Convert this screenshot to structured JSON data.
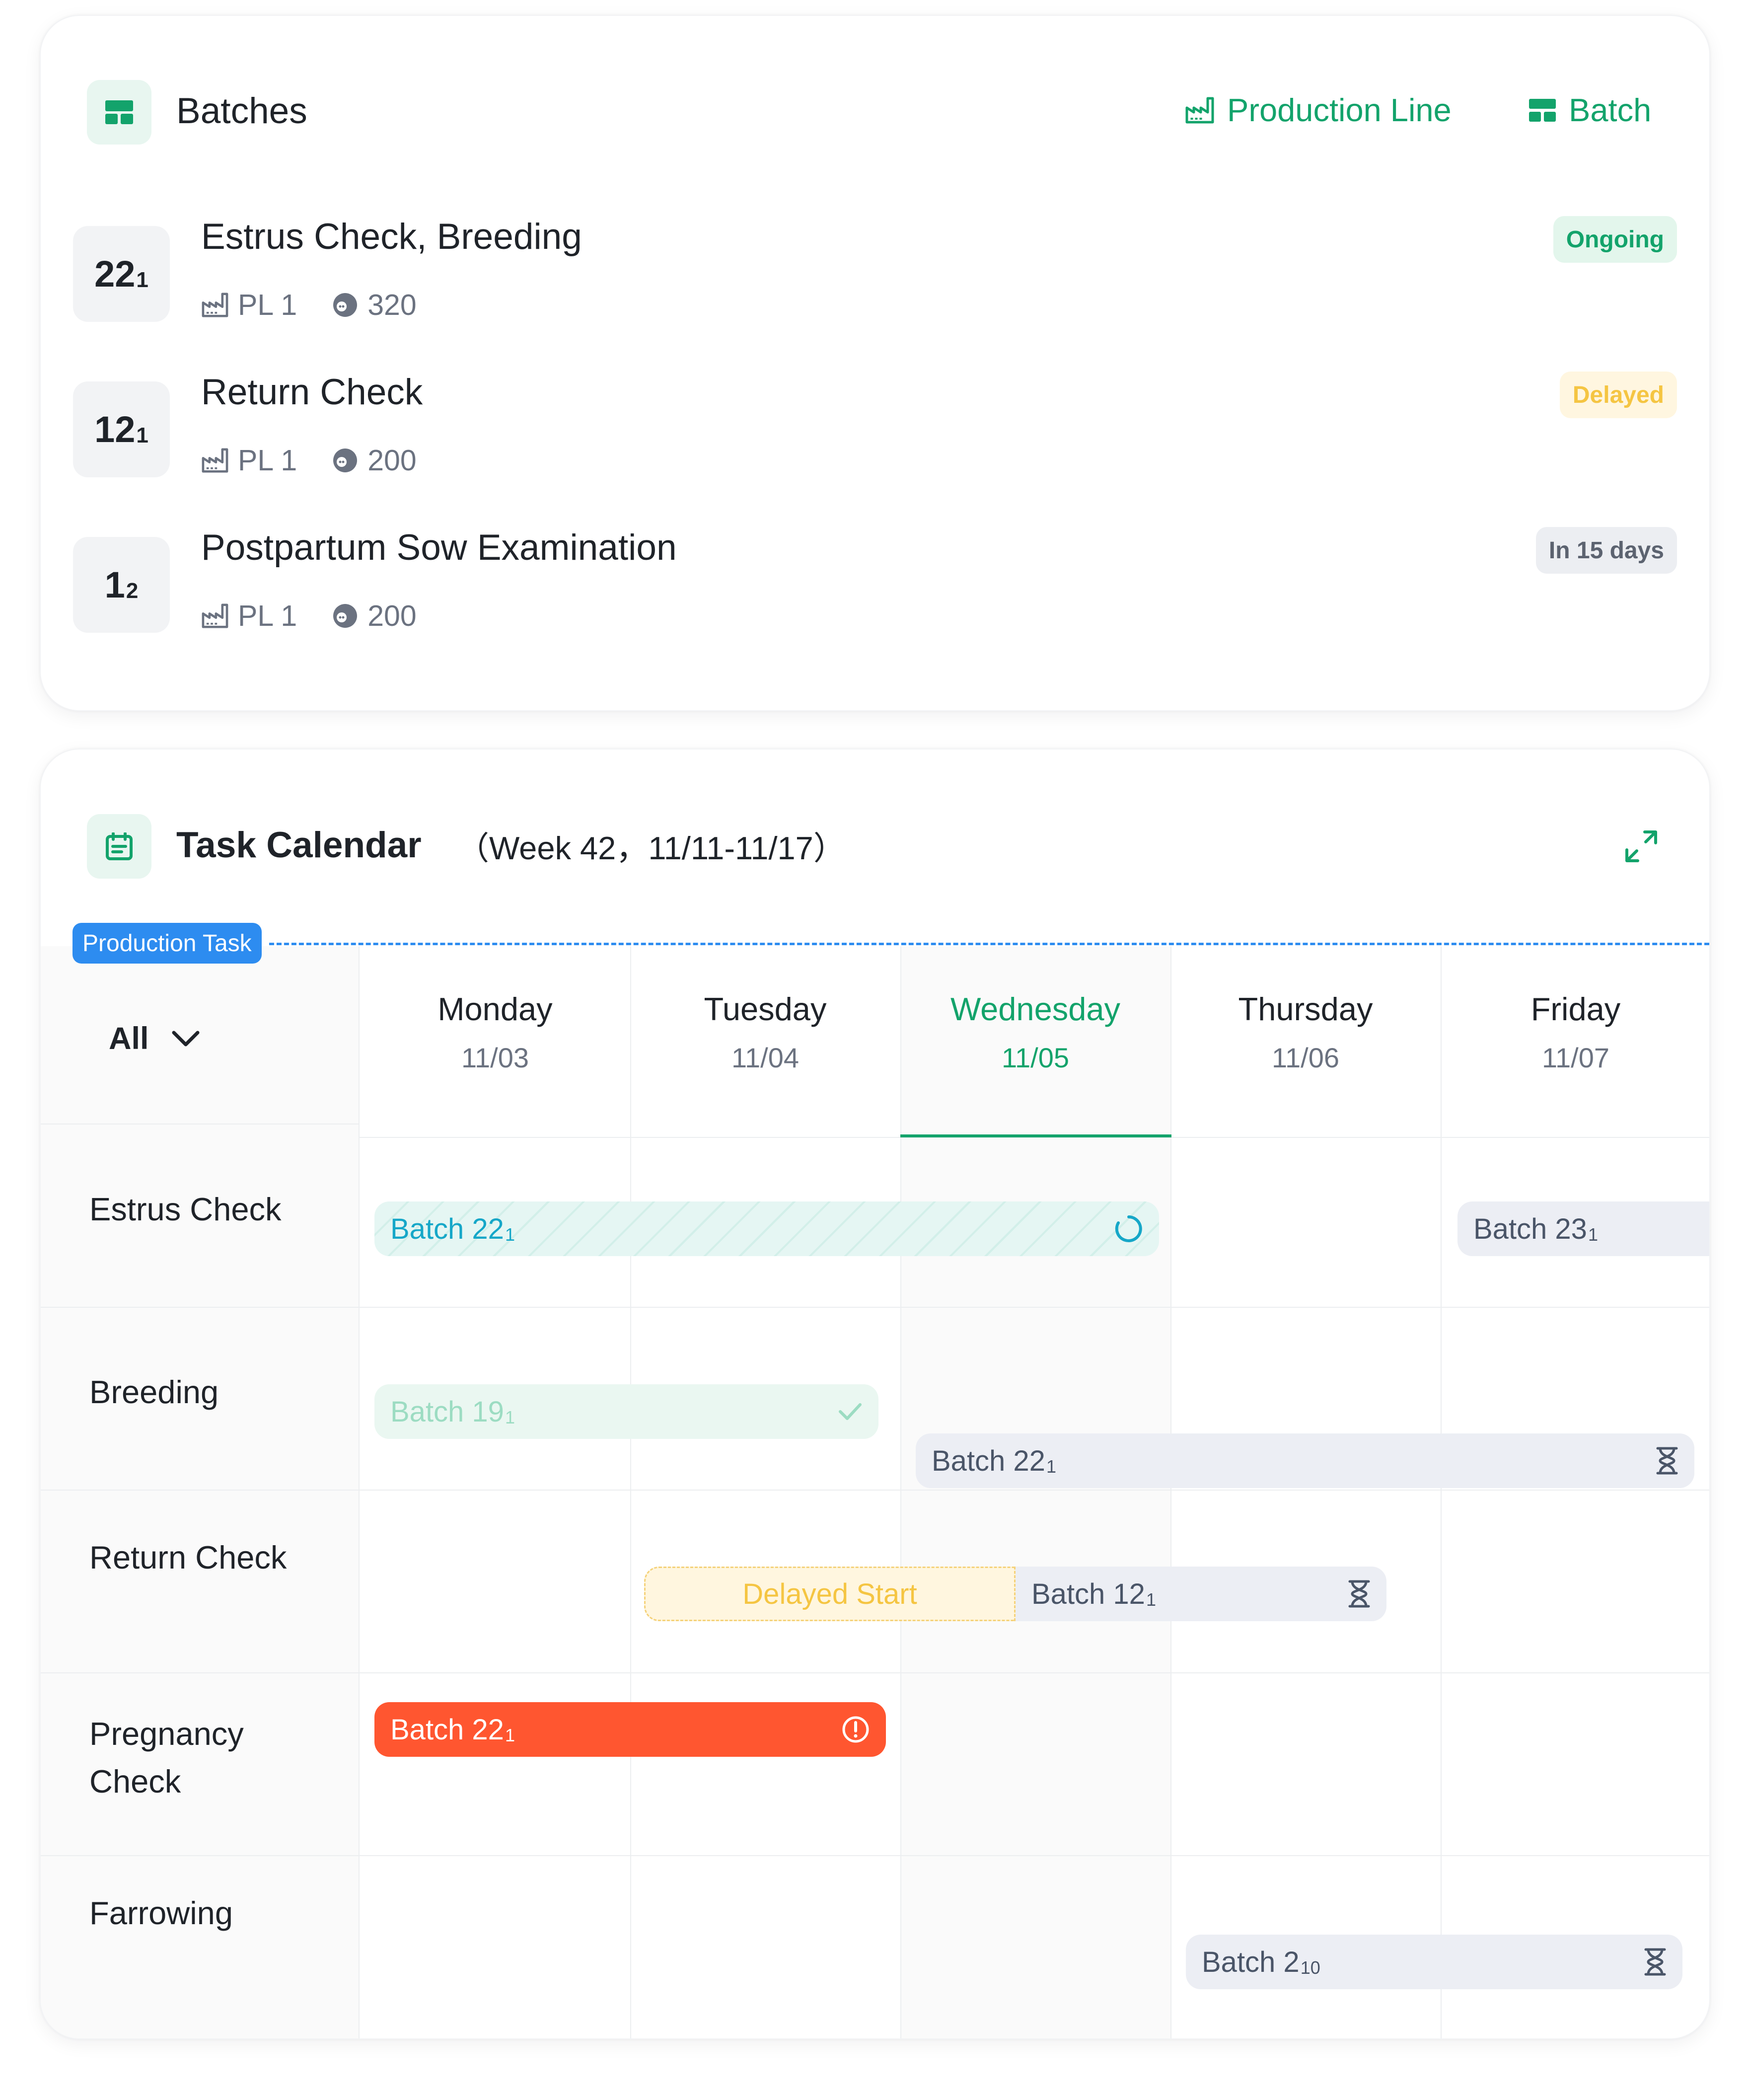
{
  "batches": {
    "title": "Batches",
    "links": [
      {
        "label": "Production Line",
        "icon": "factory-icon"
      },
      {
        "label": "Batch",
        "icon": "batch-icon"
      }
    ],
    "rows": [
      {
        "num": "22",
        "sub": "1",
        "title": "Estrus Check, Breeding",
        "line": "PL 1",
        "count": "320",
        "status": "Ongoing",
        "status_bg": "#e3f6ec",
        "status_fg": "#13a36b"
      },
      {
        "num": "12",
        "sub": "1",
        "title": "Return Check",
        "line": "PL 1",
        "count": "200",
        "status": "Delayed",
        "status_bg": "#fff6e0",
        "status_fg": "#f5c542"
      },
      {
        "num": "1",
        "sub": "2",
        "title": "Postpartum Sow Examination",
        "line": "PL 1",
        "count": "200",
        "status": "In  15 days",
        "status_bg": "#eceef2",
        "status_fg": "#5c6370"
      }
    ]
  },
  "calendar": {
    "title": "Task Calendar",
    "week": "（Week 42，11/11-11/17）",
    "production_task": "Production Task",
    "filter": "All",
    "days": [
      {
        "name": "Monday",
        "date": "11/03"
      },
      {
        "name": "Tuesday",
        "date": "11/04"
      },
      {
        "name": "Wednesday",
        "date": "11/05",
        "today": true
      },
      {
        "name": "Thursday",
        "date": "11/06"
      },
      {
        "name": "Friday",
        "date": "11/07"
      }
    ],
    "rows": [
      "Estrus Check",
      "Breeding",
      "Return Check",
      "Pregnancy Check",
      "Farrowing"
    ],
    "bars": [
      {
        "label": "Batch 22",
        "sub": "1",
        "status": "ongoing",
        "icon": "loading-icon"
      },
      {
        "label": "Batch 23",
        "sub": "1",
        "status": "pending"
      },
      {
        "label": "Batch 19",
        "sub": "1",
        "status": "done",
        "icon": "check-icon"
      },
      {
        "label": "Batch 22",
        "sub": "1",
        "status": "pending",
        "icon": "hourglass-icon"
      },
      {
        "label": "Delayed Start",
        "status": "delayed"
      },
      {
        "label": "Batch 12",
        "sub": "1",
        "status": "pending",
        "icon": "hourglass-icon"
      },
      {
        "label": "Batch 22",
        "sub": "1",
        "status": "overdue",
        "icon": "alert-icon"
      },
      {
        "label": "Batch 2",
        "sub": "10",
        "status": "pending",
        "icon": "hourglass-icon"
      }
    ],
    "colors": {
      "accent": "#13a36b",
      "blue": "#2d8cf0",
      "overdue": "#ff5630",
      "ongoing": "#16a7c8"
    }
  }
}
